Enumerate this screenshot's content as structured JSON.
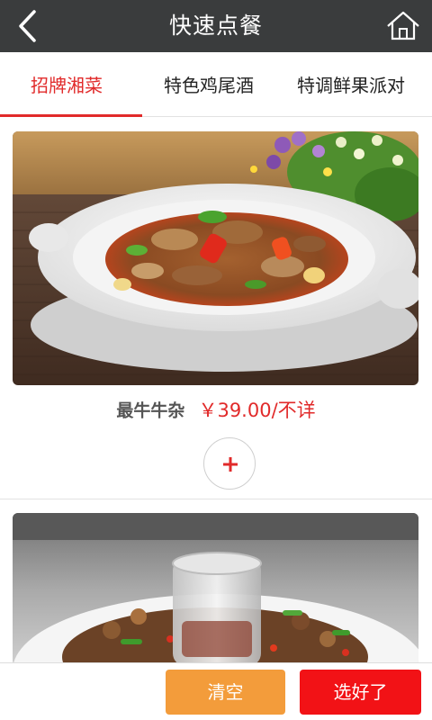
{
  "header": {
    "title": "快速点餐",
    "back_icon": "chevron-left-icon",
    "home_icon": "home-icon"
  },
  "tabs": [
    {
      "label": "招牌湘菜",
      "active": true
    },
    {
      "label": "特色鸡尾酒",
      "active": false
    },
    {
      "label": "特调鲜果派对",
      "active": false
    }
  ],
  "products": [
    {
      "name": "最牛牛杂",
      "price": "￥39.00/不详",
      "add_icon": "plus-icon"
    }
  ],
  "bottom": {
    "clear_label": "清空",
    "done_label": "选好了"
  },
  "colors": {
    "header_bg": "#3a3c3d",
    "accent": "#e12a2a",
    "clear_button": "#f39c3b",
    "done_button": "#f21216"
  }
}
